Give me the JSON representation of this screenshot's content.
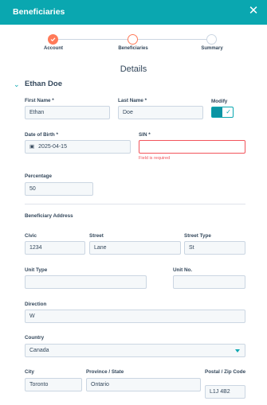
{
  "header": {
    "title": "Beneficiaries",
    "close_icon": "close-icon"
  },
  "stepper": {
    "steps": [
      {
        "label": "Account",
        "state": "done"
      },
      {
        "label": "Beneficiaries",
        "state": "active"
      },
      {
        "label": "Summary",
        "state": "pending"
      }
    ]
  },
  "section": {
    "title": "Details"
  },
  "person": {
    "name": "Ethan Doe"
  },
  "fields": {
    "first_name": {
      "label": "First Name *",
      "value": "Ethan"
    },
    "last_name": {
      "label": "Last Name *",
      "value": "Doe"
    },
    "modify": {
      "label": "Modify",
      "checked": true
    },
    "dob": {
      "label": "Date of Birth *",
      "value": "2025-04-15"
    },
    "sin": {
      "label": "SIN *",
      "value": "",
      "error": "Field is required"
    },
    "percentage": {
      "label": "Percentage",
      "value": "50"
    }
  },
  "address": {
    "heading": "Beneficiary Address",
    "civic": {
      "label": "Civic",
      "value": "1234"
    },
    "street": {
      "label": "Street",
      "value": "Lane"
    },
    "street_type": {
      "label": "Street Type",
      "value": "St"
    },
    "unit_type": {
      "label": "Unit Type",
      "value": ""
    },
    "unit_no": {
      "label": "Unit No.",
      "value": ""
    },
    "direction": {
      "label": "Direction",
      "value": "W"
    },
    "country": {
      "label": "Country",
      "value": "Canada"
    },
    "city": {
      "label": "City",
      "value": "Toronto"
    },
    "province": {
      "label": "Province / State",
      "value": "Ontario"
    },
    "postal": {
      "label": "Postal / Zip Code",
      "value": "L1J 4B2"
    }
  },
  "colors": {
    "header": "#0aa7b0",
    "accent": "#ff7a59",
    "error": "#f2545b"
  }
}
